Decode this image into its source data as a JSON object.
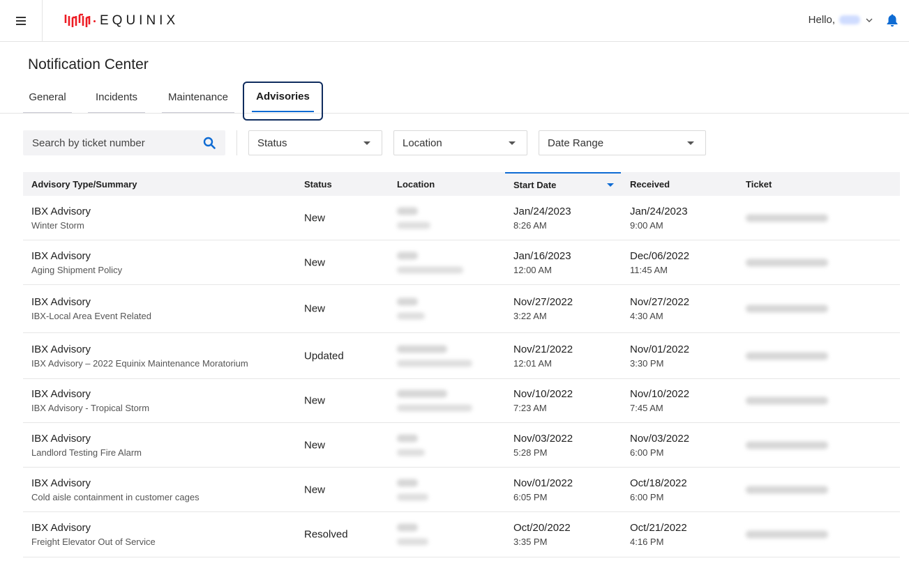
{
  "header": {
    "brand": "EQUINIX",
    "greeting": "Hello,",
    "brand_color": "#ed1c24",
    "accent_color": "#0e6bd3"
  },
  "page": {
    "title": "Notification Center"
  },
  "tabs": [
    {
      "label": "General",
      "active": false
    },
    {
      "label": "Incidents",
      "active": false
    },
    {
      "label": "Maintenance",
      "active": false
    },
    {
      "label": "Advisories",
      "active": true
    }
  ],
  "filters": {
    "search_placeholder": "Search by ticket number",
    "status": "Status",
    "location": "Location",
    "date_range": "Date Range"
  },
  "table": {
    "columns": [
      "Advisory Type/Summary",
      "Status",
      "Location",
      "Start Date",
      "Received",
      "Ticket"
    ],
    "sorted_column": "Start Date",
    "rows": [
      {
        "type": "IBX Advisory",
        "summary": "Winter Storm",
        "status": "New",
        "start_date": "Jan/24/2023",
        "start_time": "8:26 AM",
        "received_date": "Jan/24/2023",
        "received_time": "9:00 AM"
      },
      {
        "type": "IBX Advisory",
        "summary": "Aging Shipment Policy",
        "status": "New",
        "start_date": "Jan/16/2023",
        "start_time": "12:00 AM",
        "received_date": "Dec/06/2022",
        "received_time": "11:45 AM"
      },
      {
        "type": "IBX Advisory",
        "summary": "IBX-Local Area Event Related",
        "status": "New",
        "start_date": "Nov/27/2022",
        "start_time": "3:22 AM",
        "received_date": "Nov/27/2022",
        "received_time": "4:30 AM"
      },
      {
        "type": "IBX Advisory",
        "summary": "IBX Advisory – 2022 Equinix Maintenance Moratorium",
        "status": "Updated",
        "start_date": "Nov/21/2022",
        "start_time": "12:01 AM",
        "received_date": "Nov/01/2022",
        "received_time": "3:30 PM"
      },
      {
        "type": "IBX Advisory",
        "summary": "IBX Advisory - Tropical Storm",
        "status": "New",
        "start_date": "Nov/10/2022",
        "start_time": "7:23 AM",
        "received_date": "Nov/10/2022",
        "received_time": "7:45 AM"
      },
      {
        "type": "IBX Advisory",
        "summary": "Landlord Testing Fire Alarm",
        "status": "New",
        "start_date": "Nov/03/2022",
        "start_time": "5:28 PM",
        "received_date": "Nov/03/2022",
        "received_time": "6:00 PM"
      },
      {
        "type": "IBX Advisory",
        "summary": "Cold aisle containment in customer cages",
        "status": "New",
        "start_date": "Nov/01/2022",
        "start_time": "6:05 PM",
        "received_date": "Oct/18/2022",
        "received_time": "6:00 PM"
      },
      {
        "type": "IBX Advisory",
        "summary": "Freight Elevator Out of Service",
        "status": "Resolved",
        "start_date": "Oct/20/2022",
        "start_time": "3:35 PM",
        "received_date": "Oct/21/2022",
        "received_time": "4:16 PM"
      }
    ]
  },
  "icons": {
    "menu": "hamburger-menu-icon",
    "search": "search-icon",
    "bell": "bell-icon",
    "dropdown": "chevron-down-icon"
  }
}
